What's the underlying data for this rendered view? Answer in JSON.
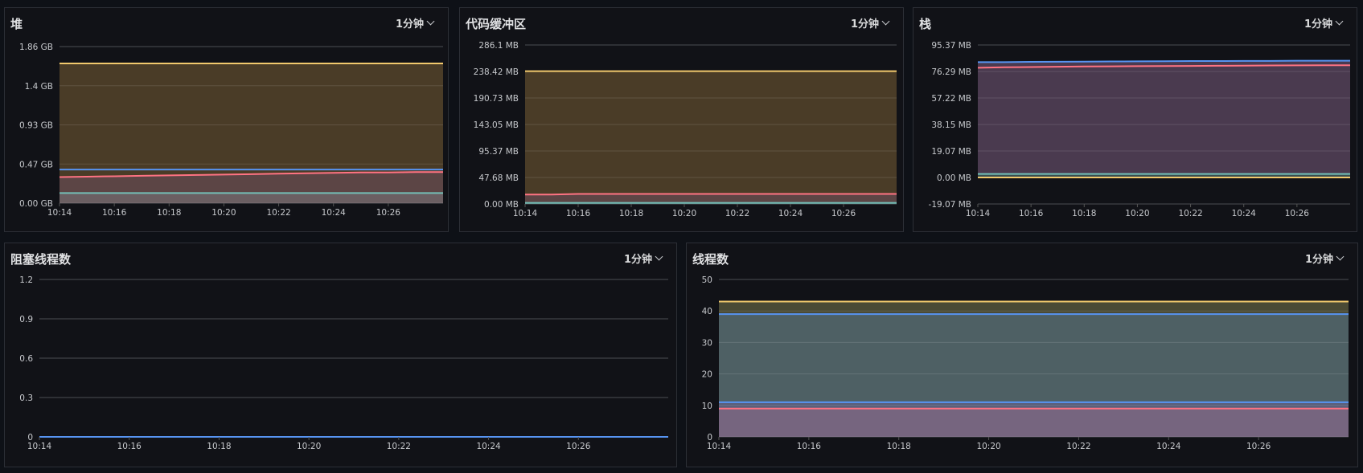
{
  "panels": {
    "heap": {
      "title": "堆",
      "interval": "1分钟",
      "chart_data": {
        "type": "area",
        "x": [
          "10:14",
          "10:15",
          "10:16",
          "10:17",
          "10:18",
          "10:19",
          "10:20",
          "10:21",
          "10:22",
          "10:23",
          "10:24",
          "10:25",
          "10:26",
          "10:27",
          "10:28"
        ],
        "xticks": [
          "10:14",
          "10:16",
          "10:18",
          "10:20",
          "10:22",
          "10:24",
          "10:26"
        ],
        "yticks": [
          "0.00 GB",
          "0.47 GB",
          "0.93 GB",
          "1.4 GB",
          "1.86 GB"
        ],
        "ylim": [
          0,
          1.86
        ],
        "series": [
          {
            "color": "#f2c96d",
            "fill": "#4a3c27",
            "values": [
              1.66,
              1.66,
              1.66,
              1.66,
              1.66,
              1.66,
              1.66,
              1.66,
              1.66,
              1.66,
              1.66,
              1.66,
              1.66,
              1.66,
              1.66
            ]
          },
          {
            "color": "#5794f2",
            "fill": "#4a3c27",
            "values": [
              0.4,
              0.4,
              0.4,
              0.4,
              0.4,
              0.4,
              0.4,
              0.4,
              0.4,
              0.4,
              0.4,
              0.4,
              0.4,
              0.4,
              0.4
            ]
          },
          {
            "color": "#ff7383",
            "fill": "#5c4545",
            "values": [
              0.31,
              0.315,
              0.32,
              0.325,
              0.33,
              0.335,
              0.34,
              0.345,
              0.35,
              0.355,
              0.36,
              0.365,
              0.365,
              0.37,
              0.37
            ]
          },
          {
            "color": "#73bfb8",
            "fill": "#6b5f62",
            "values": [
              0.12,
              0.12,
              0.12,
              0.12,
              0.12,
              0.12,
              0.12,
              0.12,
              0.12,
              0.12,
              0.12,
              0.12,
              0.12,
              0.12,
              0.12
            ]
          }
        ]
      }
    },
    "code_cache": {
      "title": "代码缓冲区",
      "interval": "1分钟",
      "chart_data": {
        "type": "area",
        "x": [
          "10:14",
          "10:15",
          "10:16",
          "10:17",
          "10:18",
          "10:19",
          "10:20",
          "10:21",
          "10:22",
          "10:23",
          "10:24",
          "10:25",
          "10:26",
          "10:27",
          "10:28"
        ],
        "xticks": [
          "10:14",
          "10:16",
          "10:18",
          "10:20",
          "10:22",
          "10:24",
          "10:26"
        ],
        "yticks": [
          "0.00 MB",
          "47.68 MB",
          "95.37 MB",
          "143.05 MB",
          "190.73 MB",
          "238.42 MB",
          "286.1 MB"
        ],
        "ylim": [
          0,
          286.1
        ],
        "series": [
          {
            "color": "#f2c96d",
            "fill": "#4a3c27",
            "values": [
              239,
              239,
              239,
              239,
              239,
              239,
              239,
              239,
              239,
              239,
              239,
              239,
              239,
              239,
              239
            ]
          },
          {
            "color": "#ff7383",
            "fill": "#5c4545",
            "values": [
              17,
              17,
              18,
              18,
              18,
              18,
              18,
              18,
              18,
              18,
              18,
              18,
              18,
              18,
              18
            ]
          },
          {
            "color": "#73bfb8",
            "fill": "#3a4f50",
            "values": [
              2,
              2,
              2,
              2,
              2,
              2,
              2,
              2,
              2,
              2,
              2,
              2,
              2,
              2,
              2
            ]
          }
        ]
      }
    },
    "stack": {
      "title": "栈",
      "interval": "1分钟",
      "chart_data": {
        "type": "area",
        "x": [
          "10:14",
          "10:15",
          "10:16",
          "10:17",
          "10:18",
          "10:19",
          "10:20",
          "10:21",
          "10:22",
          "10:23",
          "10:24",
          "10:25",
          "10:26",
          "10:27",
          "10:28"
        ],
        "xticks": [
          "10:14",
          "10:16",
          "10:18",
          "10:20",
          "10:22",
          "10:24",
          "10:26"
        ],
        "yticks": [
          "-19.07 MB",
          "0.00 MB",
          "19.07 MB",
          "38.15 MB",
          "57.22 MB",
          "76.29 MB",
          "95.37 MB"
        ],
        "ylim": [
          -19.07,
          95.37
        ],
        "series": [
          {
            "color": "#5794f2",
            "fill": "#4a3a4f",
            "values": [
              83,
              83,
              83.2,
              83.3,
              83.4,
              83.5,
              83.6,
              83.7,
              83.8,
              83.8,
              83.9,
              83.9,
              84,
              84,
              84
            ]
          },
          {
            "color": "#ff7383",
            "fill": "#4a3a4f",
            "values": [
              79,
              79.3,
              79.5,
              79.7,
              79.9,
              80,
              80.1,
              80.2,
              80.3,
              80.4,
              80.5,
              80.6,
              80.7,
              80.8,
              80.8
            ]
          },
          {
            "color": "#73bfb8",
            "fill": "#3a4f50",
            "values": [
              2.5,
              2.5,
              2.5,
              2.5,
              2.5,
              2.5,
              2.5,
              2.5,
              2.5,
              2.5,
              2.5,
              2.5,
              2.5,
              2.5,
              2.5
            ]
          },
          {
            "color": "#f2c96d",
            "fill": "none",
            "values": [
              0,
              0,
              0,
              0,
              0,
              0,
              0,
              0,
              0,
              0,
              0,
              0,
              0,
              0,
              0
            ]
          }
        ]
      }
    },
    "blocked_threads": {
      "title": "阻塞线程数",
      "interval": "1分钟",
      "chart_data": {
        "type": "line",
        "x": [
          "10:14",
          "10:15",
          "10:16",
          "10:17",
          "10:18",
          "10:19",
          "10:20",
          "10:21",
          "10:22",
          "10:23",
          "10:24",
          "10:25",
          "10:26",
          "10:27",
          "10:28"
        ],
        "xticks": [
          "10:14",
          "10:16",
          "10:18",
          "10:20",
          "10:22",
          "10:24",
          "10:26"
        ],
        "yticks": [
          "0",
          "0.3",
          "0.6",
          "0.9",
          "1.2"
        ],
        "ylim": [
          0,
          1.2
        ],
        "series": [
          {
            "color": "#5794f2",
            "fill": "none",
            "values": [
              0,
              0,
              0,
              0,
              0,
              0,
              0,
              0,
              0,
              0,
              0,
              0,
              0,
              0,
              0
            ]
          }
        ]
      }
    },
    "threads": {
      "title": "线程数",
      "interval": "1分钟",
      "chart_data": {
        "type": "area",
        "x": [
          "10:14",
          "10:15",
          "10:16",
          "10:17",
          "10:18",
          "10:19",
          "10:20",
          "10:21",
          "10:22",
          "10:23",
          "10:24",
          "10:25",
          "10:26",
          "10:27",
          "10:28"
        ],
        "xticks": [
          "10:14",
          "10:16",
          "10:18",
          "10:20",
          "10:22",
          "10:24",
          "10:26"
        ],
        "yticks": [
          "0",
          "10",
          "20",
          "30",
          "40",
          "50"
        ],
        "ylim": [
          0,
          50
        ],
        "series": [
          {
            "color": "#f2c96d",
            "fill": "#4a4a35",
            "values": [
              43,
              43,
              43,
              43,
              43,
              43,
              43,
              43,
              43,
              43,
              43,
              43,
              43,
              43,
              43
            ]
          },
          {
            "color": "#5794f2",
            "fill": "#4e6064",
            "values": [
              39,
              39,
              39,
              39,
              39,
              39,
              39,
              39,
              39,
              39,
              39,
              39,
              39,
              39,
              39
            ]
          },
          {
            "color": "#5794f2",
            "fill": "#5a5f7a",
            "values": [
              11,
              11,
              11,
              11,
              11,
              11,
              11,
              11,
              11,
              11,
              11,
              11,
              11,
              11,
              11
            ]
          },
          {
            "color": "#ff7383",
            "fill": "#76657f",
            "values": [
              9,
              9,
              9,
              9,
              9,
              9,
              9,
              9,
              9,
              9,
              9,
              9,
              9,
              9,
              9
            ]
          }
        ]
      }
    }
  }
}
